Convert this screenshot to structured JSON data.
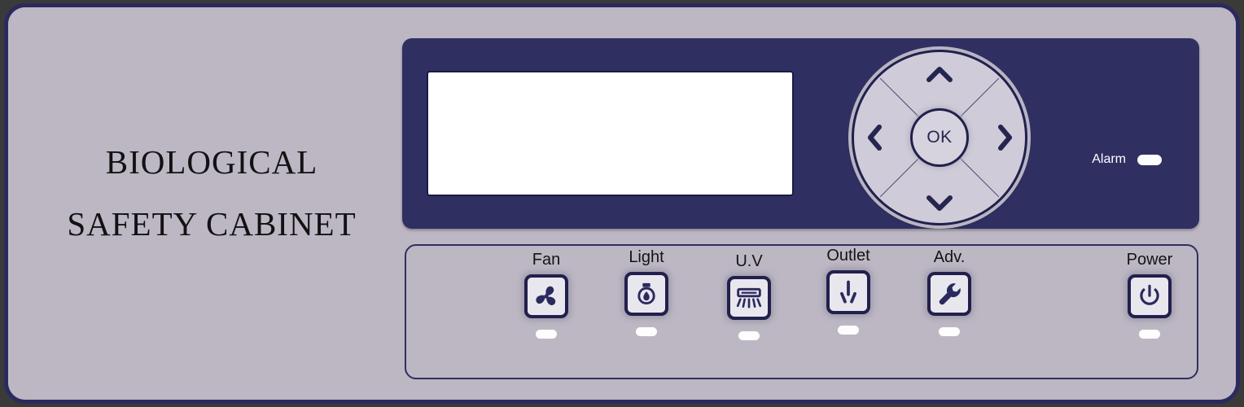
{
  "device": {
    "brand_line1": "BIOLOGICAL",
    "brand_line2": "SAFETY  CABINET",
    "frame_color": "#2b2a5e",
    "panel_color": "#bdb7c4",
    "accent_color": "#2f2f62",
    "led_color": "#fdfdfd"
  },
  "display_module": {
    "lcd": {
      "screen_text": "",
      "background": "#ffffff",
      "bezel_color": "#2f2f62"
    },
    "navpad": {
      "ok_label": "OK",
      "up_icon": "chevron-up-icon",
      "down_icon": "chevron-down-icon",
      "left_icon": "chevron-left-icon",
      "right_icon": "chevron-right-icon"
    },
    "alarm": {
      "label": "Alarm",
      "indicator": "alarm-led",
      "state": "on"
    }
  },
  "buttons": [
    {
      "label": "Fan",
      "icon": "fan-icon",
      "led": "fan-led"
    },
    {
      "label": "Light",
      "icon": "light-bulb-icon",
      "led": "light-led"
    },
    {
      "label": "U.V",
      "icon": "uv-lamp-icon",
      "led": "uv-led"
    },
    {
      "label": "Outlet",
      "icon": "power-outlet-icon",
      "led": "outlet-led"
    },
    {
      "label": "Adv.",
      "icon": "wrench-icon",
      "led": "adv-led"
    },
    {
      "label": "Power",
      "icon": "power-icon",
      "led": "power-led"
    }
  ]
}
